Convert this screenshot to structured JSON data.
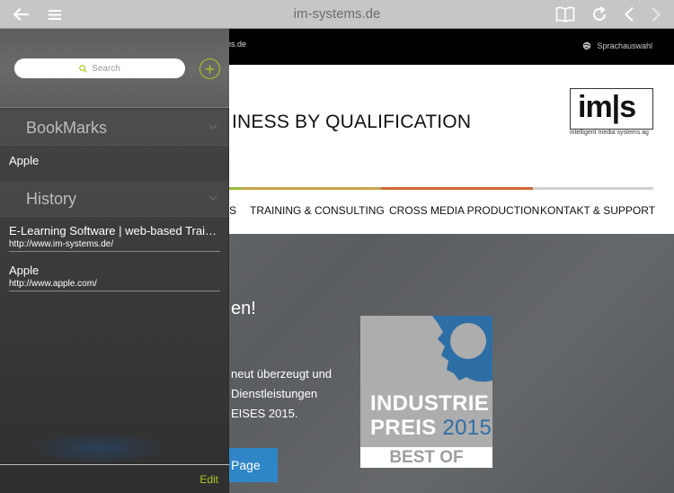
{
  "browser": {
    "url": "im-systems.de"
  },
  "icons": {
    "back": "arrow-left-icon",
    "menu": "hamburger-menu-icon",
    "bookmarks": "open-book-icon",
    "reload": "reload-icon",
    "prev": "chevron-left-icon",
    "next": "chevron-right-icon",
    "globe": "globe-icon",
    "search": "magnifier-icon",
    "add": "plus-circle-icon"
  },
  "colors": {
    "accent_green": "#b3c51f",
    "button_blue": "#2f86c7"
  },
  "sidebar": {
    "search_placeholder": "Search",
    "add_label": "+",
    "bookmarks_title": "BookMarks",
    "bookmarks": [
      {
        "title": "Apple"
      }
    ],
    "history_title": "History",
    "history": [
      {
        "title": "E-Learning Software | web-based Training",
        "url": "http://www.im-systems.de/"
      },
      {
        "title": "Apple",
        "url": "http://www.apple.com/"
      }
    ],
    "edit_label": "Edit"
  },
  "site": {
    "domain_fragment": "ns.de",
    "language_label": "Sprachauswahl",
    "slogan": "INESS BY QUALIFICATION",
    "logo_mark": "im|s",
    "logo_tagline": "intelligent media systems ag",
    "nav": [
      "S",
      "TRAINING & CONSULTING",
      "CROSS MEDIA PRODUCTION",
      "KONTAKT & SUPPORT"
    ],
    "hero_heading": "en!",
    "hero_lines": [
      "neut überzeugt und",
      "Dienstleistungen",
      "EISES 2015."
    ],
    "button_label": "Page",
    "award": {
      "line1": "INDUSTRIE",
      "line2_word": "PREIS",
      "line2_year": "2015",
      "line3": "BEST OF"
    }
  }
}
